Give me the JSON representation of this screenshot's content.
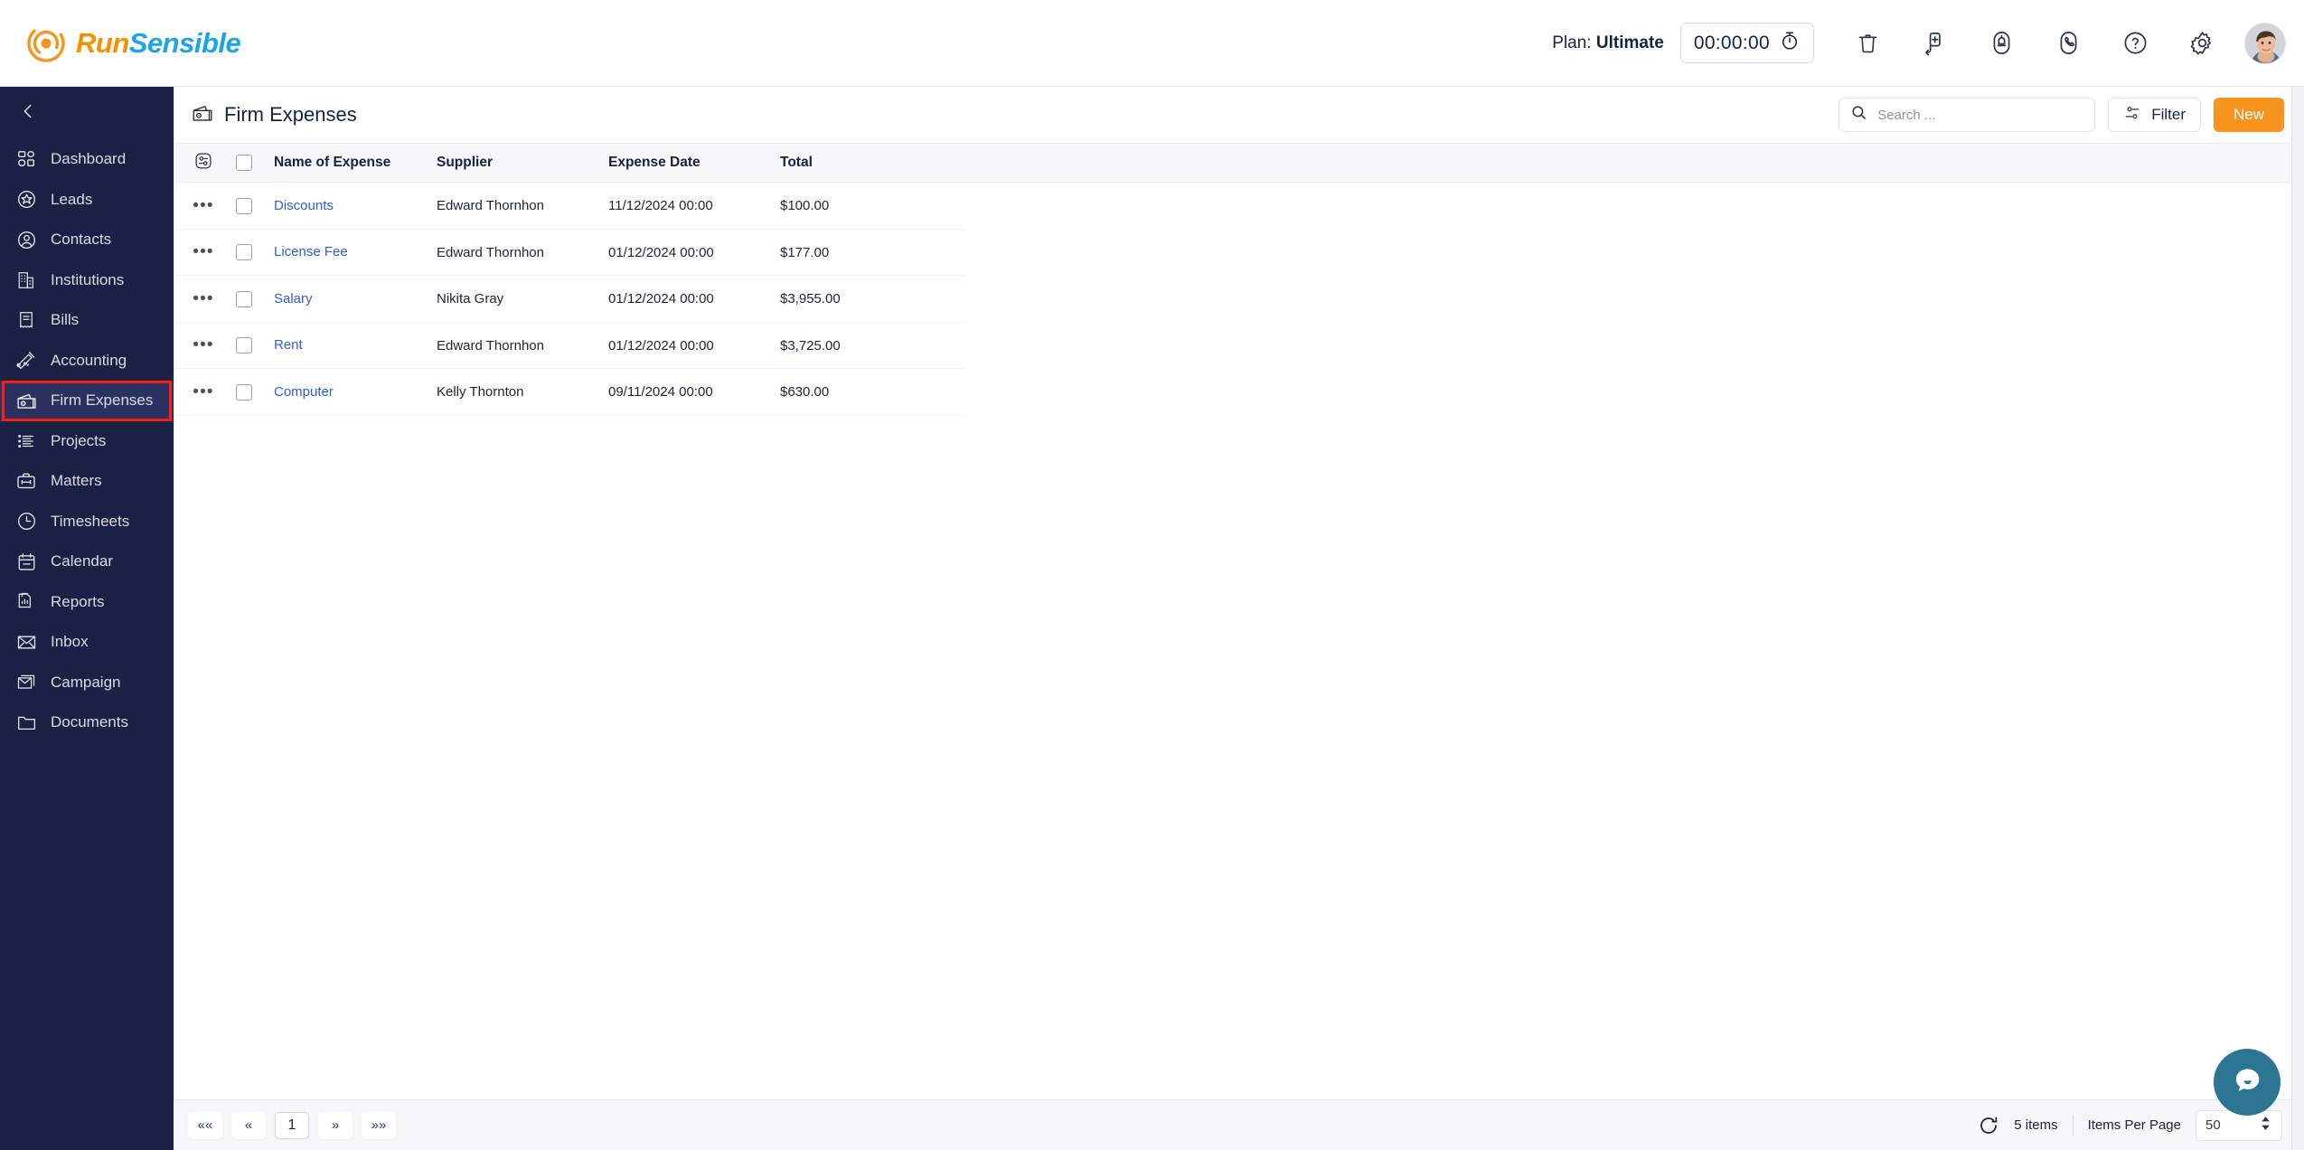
{
  "brand": {
    "name_part1": "Run",
    "name_part2": "Sensible",
    "logo_icon": "runsensible-swirl-icon"
  },
  "topbar": {
    "plan_prefix": "Plan: ",
    "plan_value": "Ultimate",
    "timer_value": "00:00:00",
    "timer_icon": "stopwatch-icon",
    "icons": [
      {
        "name": "trash-icon",
        "label": "Trash"
      },
      {
        "name": "add-circle-icon",
        "label": "Add"
      },
      {
        "name": "notification-bell-icon",
        "label": "Notifications"
      },
      {
        "name": "phone-icon",
        "label": "Calls"
      },
      {
        "name": "help-icon",
        "label": "Help"
      },
      {
        "name": "gear-icon",
        "label": "Settings"
      }
    ],
    "avatar_alt": "User avatar"
  },
  "sidebar": {
    "collapse_icon": "chevron-left-icon",
    "items": [
      {
        "label": "Dashboard",
        "icon": "dashboard-grid-icon",
        "active": false
      },
      {
        "label": "Leads",
        "icon": "star-badge-icon",
        "active": false
      },
      {
        "label": "Contacts",
        "icon": "user-circle-icon",
        "active": false
      },
      {
        "label": "Institutions",
        "icon": "building-icon",
        "active": false
      },
      {
        "label": "Bills",
        "icon": "receipt-icon",
        "active": false
      },
      {
        "label": "Accounting",
        "icon": "chart-pen-icon",
        "active": false
      },
      {
        "label": "Firm Expenses",
        "icon": "wallet-icon",
        "active": true
      },
      {
        "label": "Projects",
        "icon": "list-icon",
        "active": false
      },
      {
        "label": "Matters",
        "icon": "briefcase-icon",
        "active": false
      },
      {
        "label": "Timesheets",
        "icon": "clock-icon",
        "active": false
      },
      {
        "label": "Calendar",
        "icon": "calendar-icon",
        "active": false
      },
      {
        "label": "Reports",
        "icon": "report-chart-icon",
        "active": false
      },
      {
        "label": "Inbox",
        "icon": "envelope-icon",
        "active": false
      },
      {
        "label": "Campaign",
        "icon": "campaign-mail-icon",
        "active": false
      },
      {
        "label": "Documents",
        "icon": "folder-icon",
        "active": false
      }
    ]
  },
  "page": {
    "title": "Firm Expenses",
    "title_icon": "wallet-icon",
    "search": {
      "placeholder": "Search ...",
      "value": "",
      "icon": "search-icon"
    },
    "filter": {
      "label": "Filter",
      "icon": "filter-sliders-icon"
    },
    "new_button": {
      "label": "New",
      "color": "#f7941d"
    }
  },
  "table": {
    "settings_icon": "column-settings-icon",
    "select_all_checked": false,
    "columns": [
      "Name of Expense",
      "Supplier",
      "Expense Date",
      "Total"
    ],
    "rows": [
      {
        "name": "Discounts",
        "supplier": "Edward Thornhon",
        "date": "11/12/2024 00:00",
        "total": "$100.00",
        "checked": false
      },
      {
        "name": "License Fee",
        "supplier": "Edward Thornhon",
        "date": "01/12/2024 00:00",
        "total": "$177.00",
        "checked": false
      },
      {
        "name": "Salary",
        "supplier": "Nikita Gray",
        "date": "01/12/2024 00:00",
        "total": "$3,955.00",
        "checked": false
      },
      {
        "name": "Rent",
        "supplier": "Edward Thornhon",
        "date": "01/12/2024 00:00",
        "total": "$3,725.00",
        "checked": false
      },
      {
        "name": "Computer",
        "supplier": "Kelly Thornton",
        "date": "09/11/2024 00:00",
        "total": "$630.00",
        "checked": false
      }
    ]
  },
  "footer": {
    "pager": {
      "first": "««",
      "prev": "«",
      "current": "1",
      "next": "»",
      "last": "»»"
    },
    "refresh_icon": "refresh-icon",
    "items_count": "5 items",
    "items_per_page_label": "Items Per Page",
    "items_per_page_value": "50"
  },
  "chat": {
    "icon": "chat-bubble-icon",
    "color": "#2d7693"
  }
}
